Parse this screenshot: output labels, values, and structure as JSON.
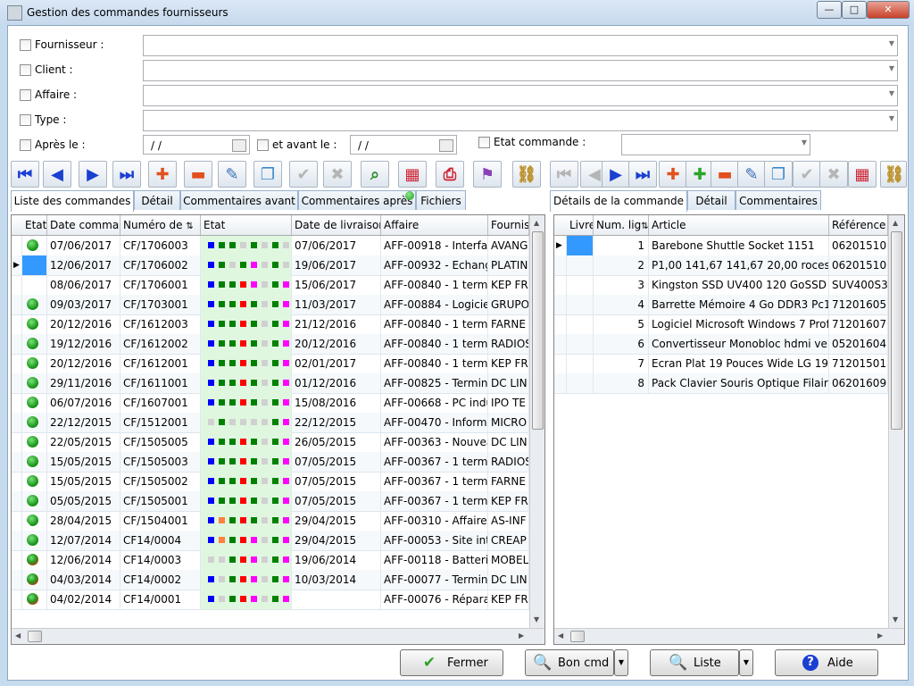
{
  "window": {
    "title": "Gestion des commandes fournisseurs"
  },
  "filters": {
    "fournisseur_label": "Fournisseur :",
    "client_label": "Client :",
    "affaire_label": "Affaire :",
    "type_label": "Type :",
    "apres_label": "Après le :",
    "avant_label": "et avant le :",
    "etat_label": "Etat commande :",
    "apres_value": "/ /",
    "avant_value": "/ /"
  },
  "colors": {
    "dot_green": "#1c9b1c",
    "blue": "#0000ff",
    "green": "#008000",
    "red": "#ff0000",
    "magenta": "#ff00ff",
    "grey": "#d0d0d0",
    "orange": "#ff8040",
    "selection": "#3399ff",
    "etat_bg": "#dff7df"
  },
  "left_tabs": [
    "Liste des commandes",
    "Détail",
    "Commentaires avant",
    "Commentaires après",
    "Fichiers"
  ],
  "right_tabs": [
    "Détails de la commande",
    "Détail",
    "Commentaires"
  ],
  "left_toolbar_icons": [
    "first-icon",
    "prev-icon",
    "next-icon",
    "last-icon",
    "add-icon",
    "remove-icon",
    "edit-icon",
    "duplicate-icon",
    "validate-icon",
    "cancel-icon",
    "search-icon",
    "calendar-icon",
    "print-icon",
    "stamp-icon",
    "link-icon"
  ],
  "right_toolbar_icons": [
    "first-icon",
    "prev-icon",
    "next-icon",
    "last-icon",
    "add-icon",
    "add-green-icon",
    "remove-icon",
    "edit-icon",
    "duplicate-icon",
    "validate-icon",
    "cancel-icon",
    "calendar-icon",
    "link-icon"
  ],
  "orders_grid": {
    "headers": [
      "Etat",
      "Date command",
      "Numéro de",
      "Etat",
      "Date de livraison",
      "Affaire",
      "Fournis"
    ],
    "rows": [
      {
        "dot": "green",
        "date": "07/06/2017",
        "num": "CF/1706003",
        "states": [
          "B",
          "G",
          "G",
          "X",
          "G",
          "X",
          "G",
          "X"
        ],
        "livraison": "07/06/2017",
        "affaire": "AFF-00918 - Interfac",
        "fournisseur": "AVANG"
      },
      {
        "dot": "selected",
        "date": "12/06/2017",
        "num": "CF/1706002",
        "states": [
          "B",
          "G",
          "X",
          "G",
          "M",
          "X",
          "G",
          "X"
        ],
        "livraison": "19/06/2017",
        "affaire": "AFF-00932 - Echang",
        "fournisseur": "PLATIN"
      },
      {
        "dot": "none",
        "date": "08/06/2017",
        "num": "CF/1706001",
        "states": [
          "B",
          "G",
          "G",
          "R",
          "M",
          "X",
          "G",
          "M"
        ],
        "livraison": "15/06/2017",
        "affaire": "AFF-00840 - 1 termi",
        "fournisseur": "KEP FR"
      },
      {
        "dot": "green",
        "date": "09/03/2017",
        "num": "CF/1703001",
        "states": [
          "B",
          "G",
          "G",
          "R",
          "G",
          "X",
          "G",
          "M"
        ],
        "livraison": "11/03/2017",
        "affaire": "AFF-00884 - Logiciel",
        "fournisseur": "GRUPO"
      },
      {
        "dot": "green",
        "date": "20/12/2016",
        "num": "CF/1612003",
        "states": [
          "B",
          "G",
          "G",
          "R",
          "G",
          "X",
          "G",
          "M"
        ],
        "livraison": "21/12/2016",
        "affaire": "AFF-00840 - 1 termi",
        "fournisseur": "FARNE"
      },
      {
        "dot": "green",
        "date": "19/12/2016",
        "num": "CF/1612002",
        "states": [
          "B",
          "G",
          "G",
          "R",
          "G",
          "X",
          "G",
          "M"
        ],
        "livraison": "20/12/2016",
        "affaire": "AFF-00840 - 1 termi",
        "fournisseur": "RADIOS"
      },
      {
        "dot": "green",
        "date": "20/12/2016",
        "num": "CF/1612001",
        "states": [
          "B",
          "G",
          "G",
          "R",
          "G",
          "X",
          "G",
          "M"
        ],
        "livraison": "02/01/2017",
        "affaire": "AFF-00840 - 1 termi",
        "fournisseur": "KEP FR"
      },
      {
        "dot": "green",
        "date": "29/11/2016",
        "num": "CF/1611001",
        "states": [
          "B",
          "G",
          "G",
          "R",
          "G",
          "X",
          "G",
          "M"
        ],
        "livraison": "01/12/2016",
        "affaire": "AFF-00825 - Termina",
        "fournisseur": "DC LIN"
      },
      {
        "dot": "green",
        "date": "06/07/2016",
        "num": "CF/1607001",
        "states": [
          "B",
          "G",
          "G",
          "R",
          "G",
          "X",
          "G",
          "M"
        ],
        "livraison": "15/08/2016",
        "affaire": "AFF-00668 - PC indu",
        "fournisseur": "IPO TE"
      },
      {
        "dot": "green",
        "date": "22/12/2015",
        "num": "CF/1512001",
        "states": [
          "X",
          "G",
          "X",
          "X",
          "X",
          "X",
          "G",
          "M"
        ],
        "livraison": "22/12/2015",
        "affaire": "AFF-00470 - Informa",
        "fournisseur": "MICRO"
      },
      {
        "dot": "green",
        "date": "22/05/2015",
        "num": "CF/1505005",
        "states": [
          "B",
          "G",
          "G",
          "R",
          "G",
          "X",
          "G",
          "M"
        ],
        "livraison": "26/05/2015",
        "affaire": "AFF-00363 - Nouvea",
        "fournisseur": "DC LIN"
      },
      {
        "dot": "green",
        "date": "15/05/2015",
        "num": "CF/1505003",
        "states": [
          "B",
          "G",
          "G",
          "R",
          "G",
          "X",
          "G",
          "M"
        ],
        "livraison": "07/05/2015",
        "affaire": "AFF-00367 - 1 termi",
        "fournisseur": "RADIOS"
      },
      {
        "dot": "green",
        "date": "15/05/2015",
        "num": "CF/1505002",
        "states": [
          "B",
          "G",
          "G",
          "R",
          "G",
          "X",
          "G",
          "M"
        ],
        "livraison": "07/05/2015",
        "affaire": "AFF-00367 - 1 termi",
        "fournisseur": "FARNE"
      },
      {
        "dot": "green",
        "date": "05/05/2015",
        "num": "CF/1505001",
        "states": [
          "B",
          "G",
          "G",
          "R",
          "G",
          "X",
          "G",
          "M"
        ],
        "livraison": "07/05/2015",
        "affaire": "AFF-00367 - 1 termi",
        "fournisseur": "KEP FR"
      },
      {
        "dot": "half",
        "date": "28/04/2015",
        "num": "CF/1504001",
        "states": [
          "B",
          "O",
          "G",
          "R",
          "G",
          "X",
          "G",
          "M"
        ],
        "livraison": "29/04/2015",
        "affaire": "AFF-00310 - Affaire",
        "fournisseur": "AS-INF"
      },
      {
        "dot": "green",
        "date": "12/07/2014",
        "num": "CF14/0004",
        "states": [
          "B",
          "O",
          "G",
          "R",
          "M",
          "X",
          "G",
          "M"
        ],
        "livraison": "29/04/2015",
        "affaire": "AFF-00053 - Site inte",
        "fournisseur": "CREAP"
      },
      {
        "dot": "red",
        "date": "12/06/2014",
        "num": "CF14/0003",
        "states": [
          "X",
          "X",
          "G",
          "R",
          "M",
          "X",
          "G",
          "M"
        ],
        "livraison": "19/06/2014",
        "affaire": "AFF-00118 - Batterie",
        "fournisseur": "MOBEL"
      },
      {
        "dot": "red",
        "date": "04/03/2014",
        "num": "CF14/0002",
        "states": [
          "B",
          "X",
          "G",
          "R",
          "M",
          "X",
          "G",
          "M"
        ],
        "livraison": "10/03/2014",
        "affaire": "AFF-00077 - Termina",
        "fournisseur": "DC LIN"
      },
      {
        "dot": "red",
        "date": "04/02/2014",
        "num": "CF14/0001",
        "states": [
          "B",
          "X",
          "G",
          "R",
          "M",
          "X",
          "G",
          "M"
        ],
        "livraison": "",
        "affaire": "AFF-00076 - Réparat",
        "fournisseur": "KEP FR"
      }
    ]
  },
  "lines_grid": {
    "headers": [
      "Livre",
      "Num. lig",
      "Article",
      "Référence"
    ],
    "rows": [
      {
        "num": "1",
        "article": "Barebone Shuttle Socket 1151",
        "ref": "062015100"
      },
      {
        "num": "2",
        "article": "P1,00 141,67 141,67 20,00 rocesse",
        "ref": "062015100"
      },
      {
        "num": "3",
        "article": "Kingston SSD UV400 120 GoSSD 1",
        "ref": "SUV400S3"
      },
      {
        "num": "4",
        "article": "Barrette Mémoire 4 Go DDR3 Pc1",
        "ref": "712016051"
      },
      {
        "num": "5",
        "article": "Logiciel Microsoft Windows 7 Prof",
        "ref": "712016070"
      },
      {
        "num": "6",
        "article": "Convertisseur Monobloc hdmi ver",
        "ref": "052016042"
      },
      {
        "num": "7",
        "article": "Ecran Plat 19 Pouces Wide LG 19M",
        "ref": "712015012"
      },
      {
        "num": "8",
        "article": "Pack Clavier Souris Optique Filaire",
        "ref": "062016090"
      }
    ]
  },
  "buttons": {
    "fermer": "Fermer",
    "bon_cmd": "Bon cmd",
    "liste": "Liste",
    "aide": "Aide"
  }
}
